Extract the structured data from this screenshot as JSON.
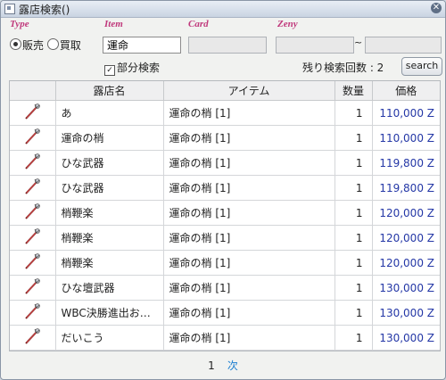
{
  "window": {
    "title": "露店検索()"
  },
  "filters": {
    "type_label": "Type",
    "item_label": "Item",
    "card_label": "Card",
    "zeny_label": "Zeny",
    "radio_sell": "販売",
    "radio_buy": "買取",
    "item_value": "運命",
    "card_value": "",
    "zeny_min": "",
    "zeny_max": "",
    "zeny_sep": "~",
    "partial_label": "部分検索",
    "remaining_label": "残り検索回数 : 2",
    "search_button": "search"
  },
  "table": {
    "columns": [
      "",
      "露店名",
      "アイテム",
      "数量",
      "価格"
    ],
    "rows": [
      {
        "shop": "あ",
        "item": "運命の梢 [1]",
        "qty": "1",
        "price": "110,000 Z"
      },
      {
        "shop": "運命の梢",
        "item": "運命の梢 [1]",
        "qty": "1",
        "price": "110,000 Z"
      },
      {
        "shop": "ひな武器",
        "item": "運命の梢 [1]",
        "qty": "1",
        "price": "119,800 Z"
      },
      {
        "shop": "ひな武器",
        "item": "運命の梢 [1]",
        "qty": "1",
        "price": "119,800 Z"
      },
      {
        "shop": "梢鞭楽",
        "item": "運命の梢 [1]",
        "qty": "1",
        "price": "120,000 Z"
      },
      {
        "shop": "梢鞭楽",
        "item": "運命の梢 [1]",
        "qty": "1",
        "price": "120,000 Z"
      },
      {
        "shop": "梢鞭楽",
        "item": "運命の梢 [1]",
        "qty": "1",
        "price": "120,000 Z"
      },
      {
        "shop": "ひな壇武器",
        "item": "運命の梢 [1]",
        "qty": "1",
        "price": "130,000 Z"
      },
      {
        "shop": "WBC決勝進出お…",
        "item": "運命の梢 [1]",
        "qty": "1",
        "price": "130,000 Z"
      },
      {
        "shop": "だいこう",
        "item": "運命の梢 [1]",
        "qty": "1",
        "price": "130,000 Z"
      }
    ]
  },
  "pager": {
    "current": "1",
    "next": "次"
  }
}
